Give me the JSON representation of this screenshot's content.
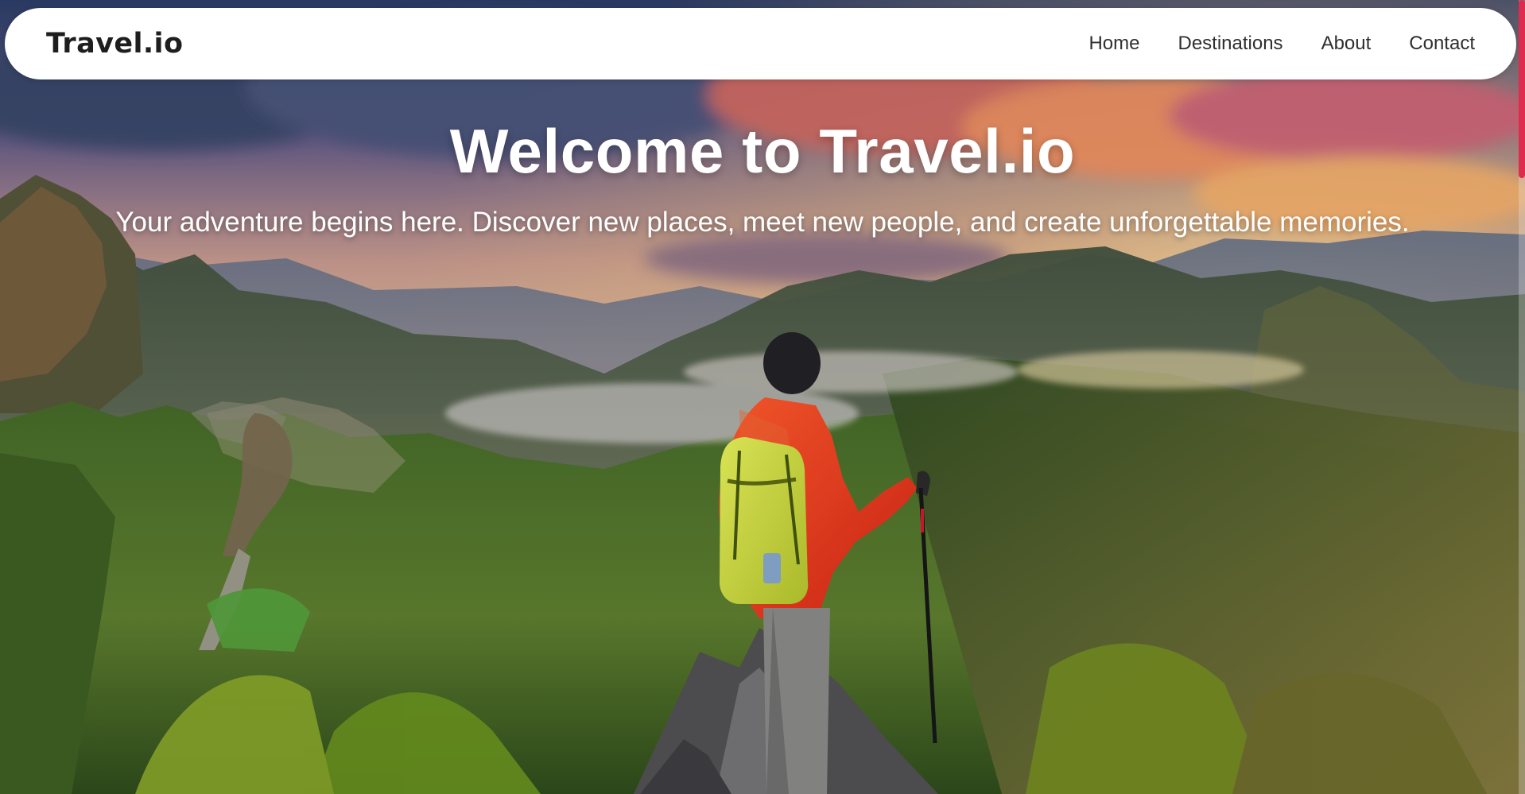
{
  "header": {
    "brand": "Travel.io",
    "nav": [
      {
        "label": "Home"
      },
      {
        "label": "Destinations"
      },
      {
        "label": "About"
      },
      {
        "label": "Contact"
      }
    ]
  },
  "hero": {
    "title": "Welcome to Travel.io",
    "subtitle": "Your adventure begins here. Discover new places, meet new people, and create unforgettable memories."
  },
  "colors": {
    "nav_background": "#ffffff",
    "brand_text": "#1e1e1e",
    "hero_text": "#ffffff",
    "scrollbar_accent": "#df2b4d"
  },
  "icons": {
    "scrollbar": "scrollbar-thumb"
  }
}
